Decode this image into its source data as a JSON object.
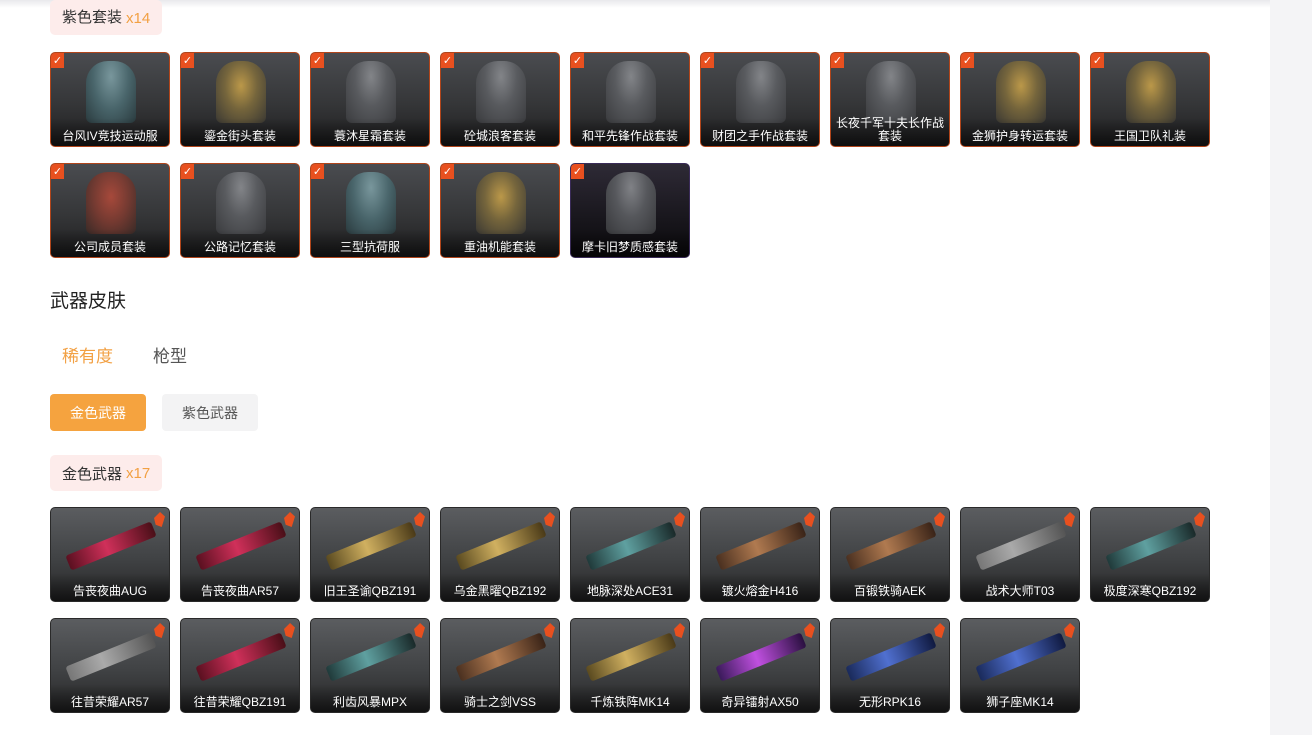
{
  "purple_suits": {
    "title": "紫色套装",
    "count": "x14",
    "items": [
      {
        "label": "台风IV竞技运动服",
        "tone": "teal",
        "checked": "✓"
      },
      {
        "label": "鎏金街头套装",
        "tone": "gold",
        "checked": "✓"
      },
      {
        "label": "蓑沐星霜套装",
        "tone": "grey",
        "checked": "✓"
      },
      {
        "label": "砼城浪客套装",
        "tone": "grey",
        "checked": "✓"
      },
      {
        "label": "和平先锋作战套装",
        "tone": "grey",
        "checked": "✓"
      },
      {
        "label": "财团之手作战套装",
        "tone": "grey",
        "checked": "✓"
      },
      {
        "label": "长夜千军十夫长作战套装",
        "tone": "grey",
        "checked": "✓"
      },
      {
        "label": "金狮护身转运套装",
        "tone": "gold",
        "checked": "✓"
      },
      {
        "label": "王国卫队礼装",
        "tone": "gold",
        "checked": "✓"
      },
      {
        "label": "公司成员套装",
        "tone": "red",
        "checked": "✓"
      },
      {
        "label": "公路记忆套装",
        "tone": "grey",
        "checked": "✓"
      },
      {
        "label": "三型抗荷服",
        "tone": "teal",
        "checked": "✓"
      },
      {
        "label": "重油机能套装",
        "tone": "gold",
        "checked": "✓"
      },
      {
        "label": "摩卡旧梦质感套装",
        "tone": "dark",
        "checked": "✓"
      }
    ]
  },
  "weapon_skins": {
    "section_title": "武器皮肤",
    "tabs": [
      {
        "label": "稀有度",
        "active": true
      },
      {
        "label": "枪型",
        "active": false
      }
    ],
    "filters": [
      {
        "label": "金色武器",
        "active": true
      },
      {
        "label": "紫色武器",
        "active": false
      }
    ]
  },
  "gold_weapons": {
    "title": "金色武器",
    "count": "x17",
    "items": [
      {
        "label": "告丧夜曲AUG",
        "tone": "red"
      },
      {
        "label": "告丧夜曲AR57",
        "tone": "red"
      },
      {
        "label": "旧王圣谕QBZ191",
        "tone": "gold"
      },
      {
        "label": "乌金黑曜QBZ192",
        "tone": "gold"
      },
      {
        "label": "地脉深处ACE31",
        "tone": "teal"
      },
      {
        "label": "镀火熔金H416",
        "tone": "bronze"
      },
      {
        "label": "百锻铁骑AEK",
        "tone": "bronze"
      },
      {
        "label": "战术大师T03",
        "tone": "grey"
      },
      {
        "label": "极度深寒QBZ192",
        "tone": "teal"
      },
      {
        "label": "往昔荣耀AR57",
        "tone": "grey"
      },
      {
        "label": "往昔荣耀QBZ191",
        "tone": "red"
      },
      {
        "label": "利齿风暴MPX",
        "tone": "teal"
      },
      {
        "label": "骑士之剑VSS",
        "tone": "bronze"
      },
      {
        "label": "千炼铁阵MK14",
        "tone": "gold"
      },
      {
        "label": "奇异镭射AX50",
        "tone": "purple"
      },
      {
        "label": "无形RPK16",
        "tone": "blue"
      },
      {
        "label": "狮子座MK14",
        "tone": "blue"
      }
    ]
  }
}
